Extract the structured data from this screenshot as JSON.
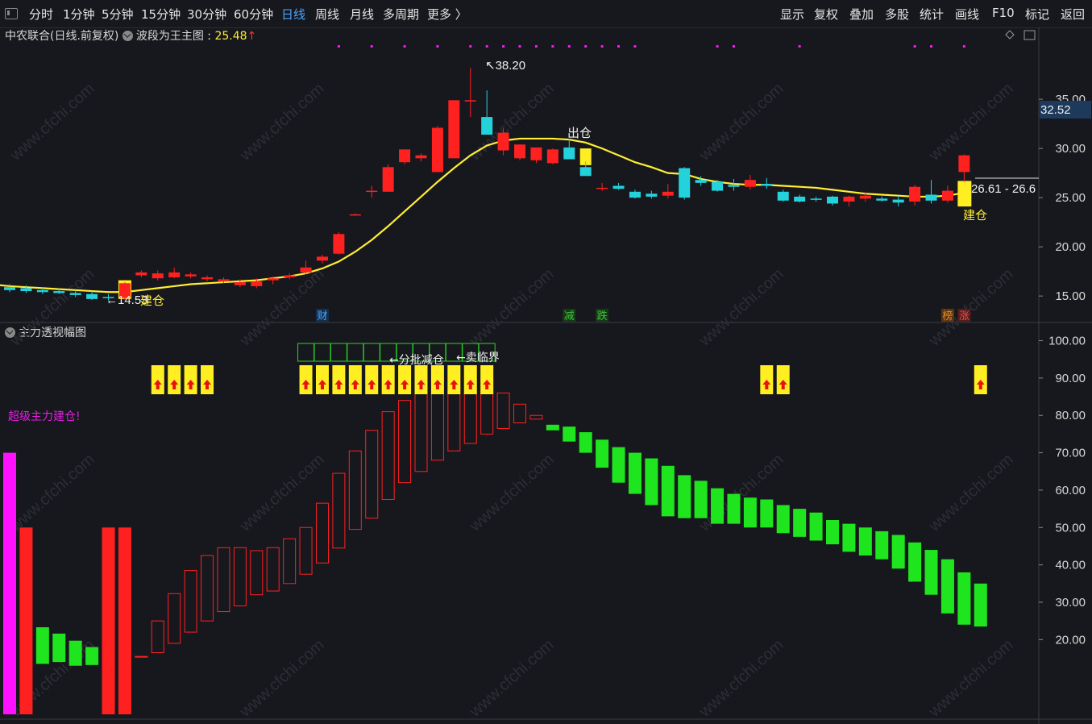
{
  "toolbar": {
    "left": [
      "分时",
      "1分钟",
      "5分钟",
      "15分钟",
      "30分钟",
      "60分钟",
      "日线",
      "周线",
      "月线",
      "多周期",
      "更多 〉"
    ],
    "active": "日线",
    "right": [
      "显示",
      "复权",
      "叠加",
      "多股",
      "统计",
      "画线",
      "F10",
      "标记",
      "返回"
    ]
  },
  "main_title": {
    "stock": "中农联合(日线.前复权)",
    "indicator": "波段为王主图",
    "value": "25.48",
    "arrow": "↑"
  },
  "indicator_title": "主力透视幅图",
  "labels": {
    "peak": "38.20",
    "low": "←14.53",
    "build1": "建仓",
    "exit": "出仓",
    "build2": "建仓",
    "last_range": "26.61 - 26.6",
    "price_tag": "32.52",
    "batch_reduce": "←分批减仓",
    "sell_critical": "←卖临界",
    "super_build": "超级主力建仓!"
  },
  "markers": [
    {
      "text": "财",
      "color": "#4aa3ff"
    },
    {
      "text": "减",
      "color": "#3ec23e"
    },
    {
      "text": "跌",
      "color": "#3ec23e"
    },
    {
      "text": "榜",
      "color": "#e08a2c"
    },
    {
      "text": "涨",
      "color": "#e05050"
    }
  ],
  "colors": {
    "up": "#ff2020",
    "down": "#24d2dc",
    "ma": "#ffee33",
    "yellow": "#ffee22",
    "green": "#1ee51e",
    "magenta": "#ff11ff"
  },
  "chart_data": [
    {
      "type": "candlestick",
      "yticks": [
        35.0,
        30.0,
        25.0,
        20.0,
        15.0
      ],
      "ylim": [
        12.8,
        40.5
      ],
      "candles": [
        {
          "o": 15.9,
          "h": 16.2,
          "l": 15.4,
          "c": 15.6
        },
        {
          "o": 15.8,
          "h": 16.1,
          "l": 15.3,
          "c": 15.5
        },
        {
          "o": 15.6,
          "h": 15.9,
          "l": 15.2,
          "c": 15.4
        },
        {
          "o": 15.5,
          "h": 15.8,
          "l": 15.2,
          "c": 15.3
        },
        {
          "o": 15.3,
          "h": 15.6,
          "l": 14.9,
          "c": 15.1
        },
        {
          "o": 15.2,
          "h": 15.5,
          "l": 14.6,
          "c": 14.7
        },
        {
          "o": 14.9,
          "h": 15.2,
          "l": 14.53,
          "c": 14.8
        },
        {
          "o": 14.8,
          "h": 16.4,
          "l": 14.6,
          "c": 16.3
        },
        {
          "o": 17.1,
          "h": 17.6,
          "l": 16.9,
          "c": 17.4
        },
        {
          "o": 16.8,
          "h": 17.6,
          "l": 16.6,
          "c": 17.3
        },
        {
          "o": 16.9,
          "h": 17.9,
          "l": 16.8,
          "c": 17.4
        },
        {
          "o": 17.0,
          "h": 17.4,
          "l": 16.8,
          "c": 17.2
        },
        {
          "o": 16.7,
          "h": 17.1,
          "l": 16.5,
          "c": 16.9
        },
        {
          "o": 16.5,
          "h": 16.9,
          "l": 16.3,
          "c": 16.7
        },
        {
          "o": 16.1,
          "h": 16.7,
          "l": 15.9,
          "c": 16.4
        },
        {
          "o": 16.0,
          "h": 16.8,
          "l": 15.8,
          "c": 16.5
        },
        {
          "o": 16.6,
          "h": 17.0,
          "l": 16.2,
          "c": 16.8
        },
        {
          "o": 16.9,
          "h": 17.3,
          "l": 16.7,
          "c": 17.1
        },
        {
          "o": 17.4,
          "h": 18.6,
          "l": 17.2,
          "c": 17.9
        },
        {
          "o": 18.6,
          "h": 19.2,
          "l": 18.3,
          "c": 19.0
        },
        {
          "o": 19.3,
          "h": 21.5,
          "l": 19.2,
          "c": 21.3
        },
        {
          "o": 23.3,
          "h": 23.4,
          "l": 23.2,
          "c": 23.3
        },
        {
          "o": 25.6,
          "h": 26.2,
          "l": 25.0,
          "c": 25.7
        },
        {
          "o": 25.6,
          "h": 28.4,
          "l": 25.6,
          "c": 28.1
        },
        {
          "o": 28.6,
          "h": 29.9,
          "l": 28.4,
          "c": 29.9
        },
        {
          "o": 29.0,
          "h": 29.5,
          "l": 28.7,
          "c": 29.3
        },
        {
          "o": 27.6,
          "h": 32.3,
          "l": 27.6,
          "c": 32.1
        },
        {
          "o": 29.0,
          "h": 34.9,
          "l": 29.0,
          "c": 34.9
        },
        {
          "o": 34.9,
          "h": 38.2,
          "l": 33.2,
          "c": 34.9
        },
        {
          "o": 33.2,
          "h": 35.9,
          "l": 31.5,
          "c": 31.4
        },
        {
          "o": 29.8,
          "h": 32.1,
          "l": 29.3,
          "c": 31.6
        },
        {
          "o": 29.0,
          "h": 30.4,
          "l": 28.8,
          "c": 30.4
        },
        {
          "o": 28.8,
          "h": 30.1,
          "l": 28.5,
          "c": 30.1
        },
        {
          "o": 28.5,
          "h": 30.0,
          "l": 28.4,
          "c": 29.9
        },
        {
          "o": 30.1,
          "h": 31.0,
          "l": 29.6,
          "c": 28.9
        },
        {
          "o": 28.1,
          "h": 28.7,
          "l": 27.3,
          "c": 27.2
        },
        {
          "o": 25.9,
          "h": 26.5,
          "l": 25.7,
          "c": 26.0
        },
        {
          "o": 26.2,
          "h": 26.5,
          "l": 25.8,
          "c": 25.9
        },
        {
          "o": 25.6,
          "h": 25.8,
          "l": 24.9,
          "c": 25.0
        },
        {
          "o": 25.4,
          "h": 25.7,
          "l": 24.9,
          "c": 25.1
        },
        {
          "o": 25.2,
          "h": 26.4,
          "l": 24.9,
          "c": 25.6
        },
        {
          "o": 28.0,
          "h": 28.1,
          "l": 24.8,
          "c": 25.0
        },
        {
          "o": 26.8,
          "h": 27.2,
          "l": 26.2,
          "c": 26.5
        },
        {
          "o": 26.6,
          "h": 26.8,
          "l": 25.6,
          "c": 25.7
        },
        {
          "o": 26.3,
          "h": 26.9,
          "l": 25.7,
          "c": 26.1
        },
        {
          "o": 26.1,
          "h": 27.3,
          "l": 25.8,
          "c": 26.8
        },
        {
          "o": 26.4,
          "h": 27.0,
          "l": 25.9,
          "c": 26.2
        },
        {
          "o": 25.6,
          "h": 25.8,
          "l": 24.6,
          "c": 24.7
        },
        {
          "o": 25.1,
          "h": 25.3,
          "l": 24.5,
          "c": 24.6
        },
        {
          "o": 24.9,
          "h": 25.1,
          "l": 24.6,
          "c": 24.8
        },
        {
          "o": 25.1,
          "h": 25.2,
          "l": 24.2,
          "c": 24.4
        },
        {
          "o": 24.6,
          "h": 25.2,
          "l": 24.1,
          "c": 25.1
        },
        {
          "o": 24.9,
          "h": 25.6,
          "l": 24.6,
          "c": 25.2
        },
        {
          "o": 24.9,
          "h": 25.1,
          "l": 24.6,
          "c": 24.7
        },
        {
          "o": 24.8,
          "h": 25.2,
          "l": 24.1,
          "c": 24.5
        },
        {
          "o": 24.6,
          "h": 26.3,
          "l": 24.2,
          "c": 26.1
        },
        {
          "o": 25.3,
          "h": 26.8,
          "l": 24.4,
          "c": 24.7
        },
        {
          "o": 24.7,
          "h": 26.2,
          "l": 24.5,
          "c": 25.7
        },
        {
          "o": 27.6,
          "h": 29.4,
          "l": 26.6,
          "c": 29.3
        }
      ],
      "ma": [
        16.0,
        15.9,
        15.8,
        15.7,
        15.6,
        15.5,
        15.4,
        15.4,
        15.6,
        15.8,
        16.0,
        16.2,
        16.3,
        16.4,
        16.5,
        16.6,
        16.8,
        17.0,
        17.3,
        17.8,
        18.5,
        19.5,
        20.7,
        22.1,
        23.6,
        25.1,
        26.6,
        28.0,
        29.3,
        30.3,
        30.8,
        31.0,
        31.0,
        31.0,
        30.9,
        30.6,
        30.0,
        29.3,
        28.6,
        28.1,
        27.5,
        27.4,
        26.9,
        26.6,
        26.4,
        26.3,
        26.3,
        26.2,
        26.1,
        26.0,
        25.8,
        25.6,
        25.4,
        25.3,
        25.2,
        25.1,
        25.1,
        25.2,
        25.5
      ]
    },
    {
      "type": "bar",
      "yticks": [
        100.0,
        90.0,
        80.0,
        70.0,
        60.0,
        50.0,
        40.0,
        30.0,
        20.0
      ],
      "ylim": [
        0,
        104
      ],
      "bars": [
        {
          "lo": 0,
          "hi": 70.0,
          "c": "m"
        },
        {
          "lo": 0,
          "hi": 50.0,
          "c": "r"
        },
        {
          "lo": 13.5,
          "hi": 23.3,
          "c": "g"
        },
        {
          "lo": 14.0,
          "hi": 21.6,
          "c": "g"
        },
        {
          "lo": 13.0,
          "hi": 19.7,
          "c": "g"
        },
        {
          "lo": 13.2,
          "hi": 18.0,
          "c": "g"
        },
        {
          "lo": 0,
          "hi": 50.0,
          "c": "r"
        },
        {
          "lo": 0,
          "hi": 50.0,
          "c": "r"
        },
        {
          "lo": 15.3,
          "hi": 15.5,
          "c": "ro"
        },
        {
          "lo": 16.5,
          "hi": 25.0,
          "c": "ro"
        },
        {
          "lo": 19.0,
          "hi": 32.3,
          "c": "ro"
        },
        {
          "lo": 22.0,
          "hi": 38.5,
          "c": "ro"
        },
        {
          "lo": 25.0,
          "hi": 42.5,
          "c": "ro"
        },
        {
          "lo": 27.5,
          "hi": 44.6,
          "c": "ro"
        },
        {
          "lo": 29.0,
          "hi": 44.6,
          "c": "ro"
        },
        {
          "lo": 32.0,
          "hi": 43.8,
          "c": "ro"
        },
        {
          "lo": 33.0,
          "hi": 44.6,
          "c": "ro"
        },
        {
          "lo": 35.0,
          "hi": 47.0,
          "c": "ro"
        },
        {
          "lo": 37.5,
          "hi": 50.0,
          "c": "ro"
        },
        {
          "lo": 40.5,
          "hi": 56.5,
          "c": "ro"
        },
        {
          "lo": 44.5,
          "hi": 64.5,
          "c": "ro"
        },
        {
          "lo": 49.5,
          "hi": 70.5,
          "c": "ro"
        },
        {
          "lo": 52.5,
          "hi": 76.0,
          "c": "ro"
        },
        {
          "lo": 57.5,
          "hi": 81.0,
          "c": "ro"
        },
        {
          "lo": 62.0,
          "hi": 84.0,
          "c": "ro"
        },
        {
          "lo": 65.0,
          "hi": 86.0,
          "c": "ro"
        },
        {
          "lo": 68.0,
          "hi": 86.0,
          "c": "ro"
        },
        {
          "lo": 70.5,
          "hi": 86.0,
          "c": "ro"
        },
        {
          "lo": 72.5,
          "hi": 86.0,
          "c": "ro"
        },
        {
          "lo": 75.0,
          "hi": 86.0,
          "c": "ro"
        },
        {
          "lo": 76.5,
          "hi": 86.0,
          "c": "ro"
        },
        {
          "lo": 78.0,
          "hi": 83.0,
          "c": "ro"
        },
        {
          "lo": 79.0,
          "hi": 80.0,
          "c": "ro"
        },
        {
          "lo": 76.0,
          "hi": 77.5,
          "c": "g"
        },
        {
          "lo": 73.0,
          "hi": 77.0,
          "c": "g"
        },
        {
          "lo": 70.0,
          "hi": 75.5,
          "c": "g"
        },
        {
          "lo": 66.0,
          "hi": 73.5,
          "c": "g"
        },
        {
          "lo": 62.0,
          "hi": 71.5,
          "c": "g"
        },
        {
          "lo": 59.0,
          "hi": 70.0,
          "c": "g"
        },
        {
          "lo": 56.0,
          "hi": 68.5,
          "c": "g"
        },
        {
          "lo": 53.0,
          "hi": 66.5,
          "c": "g"
        },
        {
          "lo": 52.5,
          "hi": 64.0,
          "c": "g"
        },
        {
          "lo": 52.5,
          "hi": 62.5,
          "c": "g"
        },
        {
          "lo": 51.0,
          "hi": 60.5,
          "c": "g"
        },
        {
          "lo": 51.0,
          "hi": 59.0,
          "c": "g"
        },
        {
          "lo": 50.0,
          "hi": 58.0,
          "c": "g"
        },
        {
          "lo": 50.0,
          "hi": 57.5,
          "c": "g"
        },
        {
          "lo": 48.5,
          "hi": 56.0,
          "c": "g"
        },
        {
          "lo": 47.5,
          "hi": 55.0,
          "c": "g"
        },
        {
          "lo": 46.5,
          "hi": 54.0,
          "c": "g"
        },
        {
          "lo": 45.5,
          "hi": 52.0,
          "c": "g"
        },
        {
          "lo": 43.5,
          "hi": 51.0,
          "c": "g"
        },
        {
          "lo": 42.5,
          "hi": 50.0,
          "c": "g"
        },
        {
          "lo": 41.5,
          "hi": 49.0,
          "c": "g"
        },
        {
          "lo": 39.0,
          "hi": 48.0,
          "c": "g"
        },
        {
          "lo": 35.5,
          "hi": 46.0,
          "c": "g"
        },
        {
          "lo": 32.0,
          "hi": 44.0,
          "c": "g"
        },
        {
          "lo": 27.0,
          "hi": 41.5,
          "c": "g"
        },
        {
          "lo": 24.0,
          "hi": 38.0,
          "c": "g"
        },
        {
          "lo": 23.5,
          "hi": 35.0,
          "c": "g"
        }
      ],
      "up_arrows": [
        9,
        10,
        11,
        12,
        18,
        19,
        20,
        21,
        22,
        23,
        24,
        25,
        26,
        27,
        28,
        29,
        46,
        47,
        59
      ],
      "green_boxes": [
        18,
        19,
        20,
        21,
        22,
        23,
        24,
        25,
        26,
        27,
        28,
        29
      ]
    }
  ]
}
